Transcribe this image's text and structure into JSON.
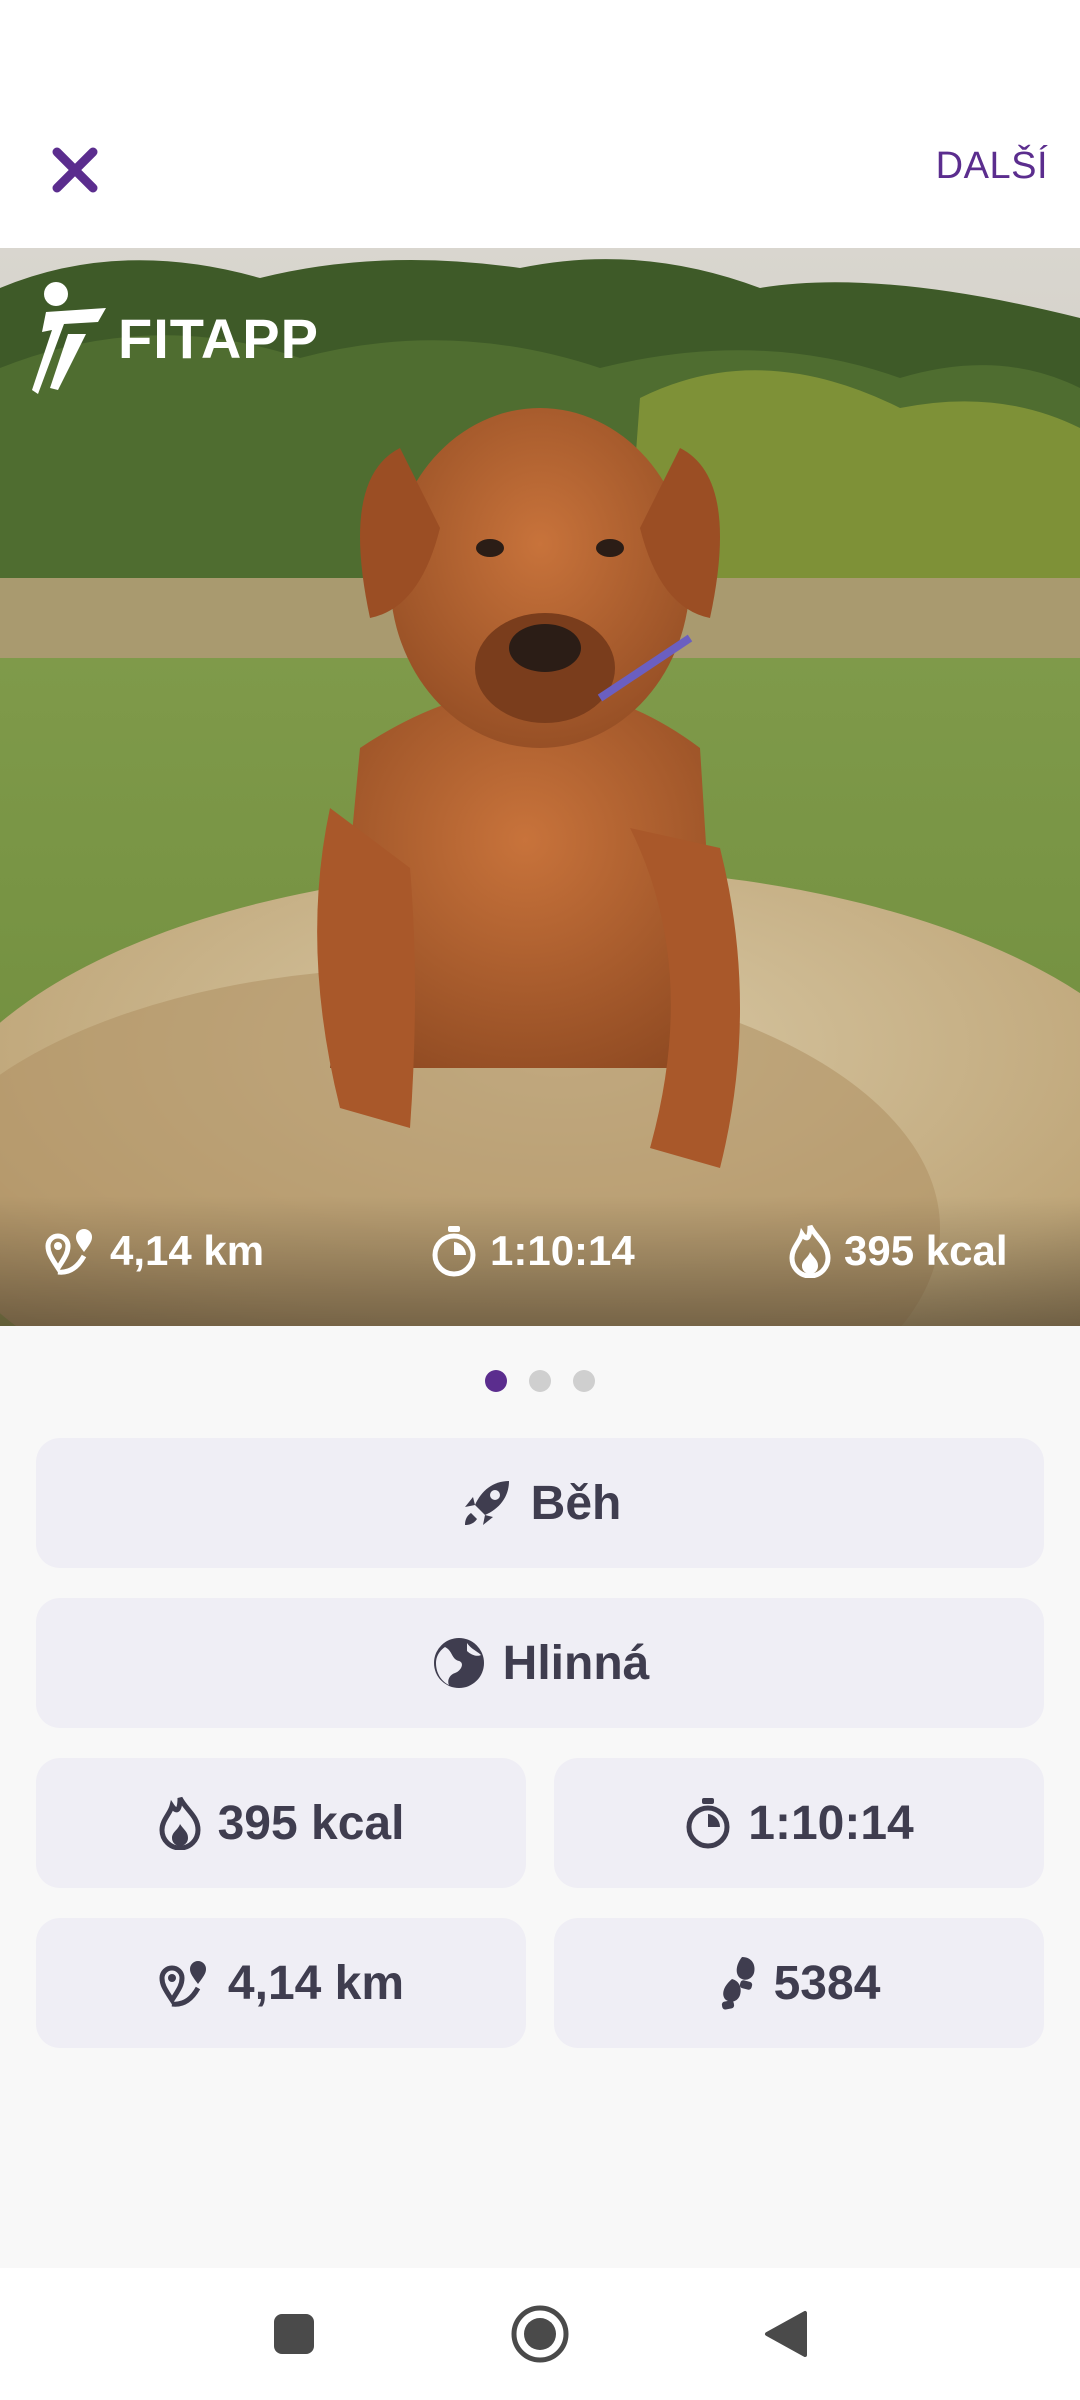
{
  "header": {
    "next_label": "DALŠÍ"
  },
  "photo": {
    "brand": "FITAPP",
    "distance": "4,14 km",
    "duration": "1:10:14",
    "calories": "395 kcal"
  },
  "pager": {
    "count": 3,
    "active": 1
  },
  "summary": {
    "activity": "Běh",
    "location": "Hlinná",
    "calories": "395 kcal",
    "duration": "1:10:14",
    "distance": "4,14 km",
    "steps": "5384"
  },
  "colors": {
    "accent": "#5b2d8e",
    "card": "#efeef5",
    "text": "#3f3d4f"
  },
  "icons": [
    "close-icon",
    "runner-logo-icon",
    "route-icon",
    "stopwatch-icon",
    "flame-icon",
    "rocket-icon",
    "globe-icon",
    "footprints-icon",
    "square-icon",
    "circle-icon",
    "back-triangle-icon"
  ]
}
